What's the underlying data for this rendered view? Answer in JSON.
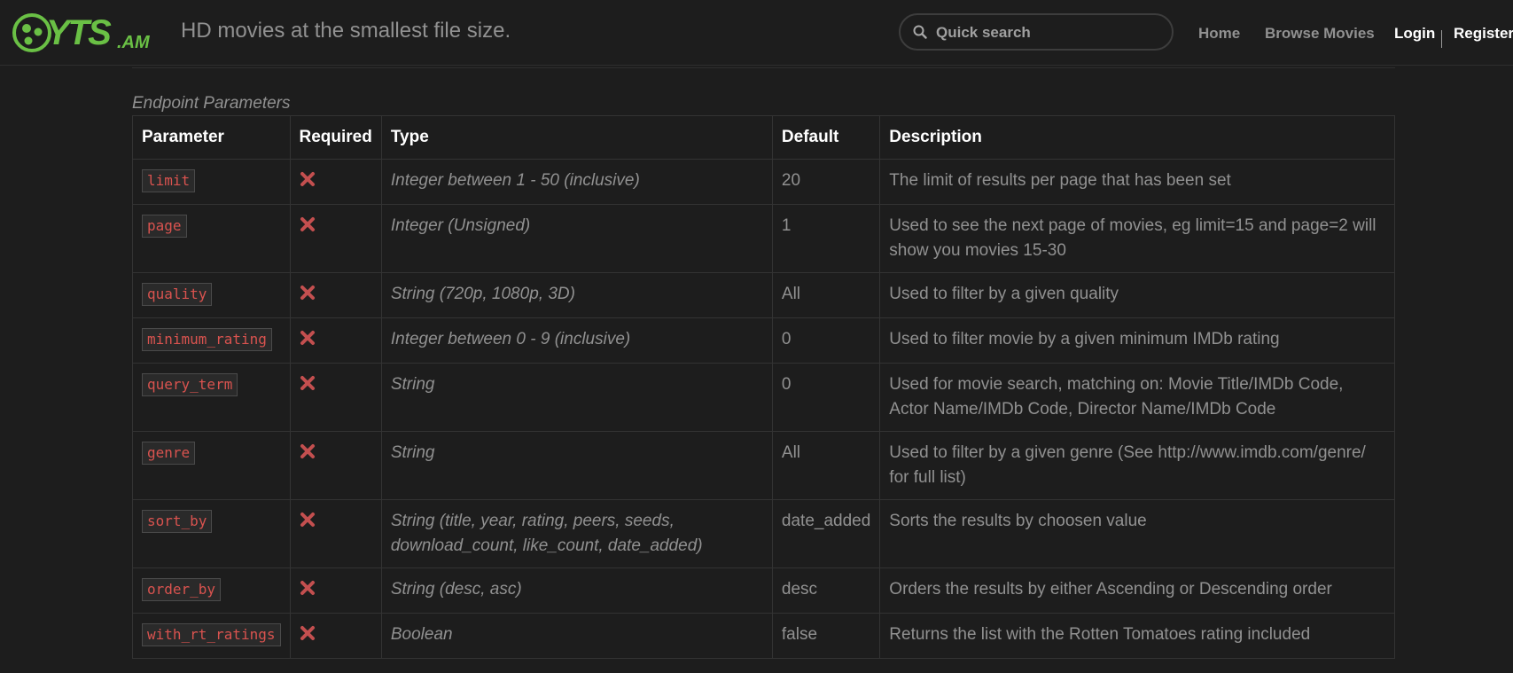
{
  "header": {
    "logo_text": "YTS.AM",
    "tagline": "HD movies at the smallest file size.",
    "search_placeholder": "Quick search",
    "nav": {
      "home": "Home",
      "browse": "Browse Movies",
      "login": "Login",
      "register": "Register"
    }
  },
  "colors": {
    "brand_green": "#6ac045",
    "param_red": "#d9534f",
    "x_icon": "#c34f4f"
  },
  "section": {
    "caption": "Endpoint Parameters"
  },
  "table": {
    "headers": [
      "Parameter",
      "Required",
      "Type",
      "Default",
      "Description"
    ],
    "rows": [
      {
        "param": "limit",
        "required_icon": "x-icon",
        "type": "Integer between 1 - 50 (inclusive)",
        "default": "20",
        "description": "The limit of results per page that has been set"
      },
      {
        "param": "page",
        "required_icon": "x-icon",
        "type": "Integer (Unsigned)",
        "default": "1",
        "description": "Used to see the next page of movies, eg limit=15 and page=2 will show you movies 15-30"
      },
      {
        "param": "quality",
        "required_icon": "x-icon",
        "type": "String (720p, 1080p, 3D)",
        "default": "All",
        "description": "Used to filter by a given quality"
      },
      {
        "param": "minimum_rating",
        "required_icon": "x-icon",
        "type": "Integer between 0 - 9 (inclusive)",
        "default": "0",
        "description": "Used to filter movie by a given minimum IMDb rating"
      },
      {
        "param": "query_term",
        "required_icon": "x-icon",
        "type": "String",
        "default": "0",
        "description": "Used for movie search, matching on: Movie Title/IMDb Code, Actor Name/IMDb Code, Director Name/IMDb Code"
      },
      {
        "param": "genre",
        "required_icon": "x-icon",
        "type": "String",
        "default": "All",
        "description": "Used to filter by a given genre (See http://www.imdb.com/genre/ for full list)"
      },
      {
        "param": "sort_by",
        "required_icon": "x-icon",
        "type": "String (title, year, rating, peers, seeds, download_count, like_count, date_added)",
        "default": "date_added",
        "description": "Sorts the results by choosen value"
      },
      {
        "param": "order_by",
        "required_icon": "x-icon",
        "type": "String (desc, asc)",
        "default": "desc",
        "description": "Orders the results by either Ascending or Descending order"
      },
      {
        "param": "with_rt_ratings",
        "required_icon": "x-icon",
        "type": "Boolean",
        "default": "false",
        "description": "Returns the list with the Rotten Tomatoes rating included"
      }
    ]
  }
}
